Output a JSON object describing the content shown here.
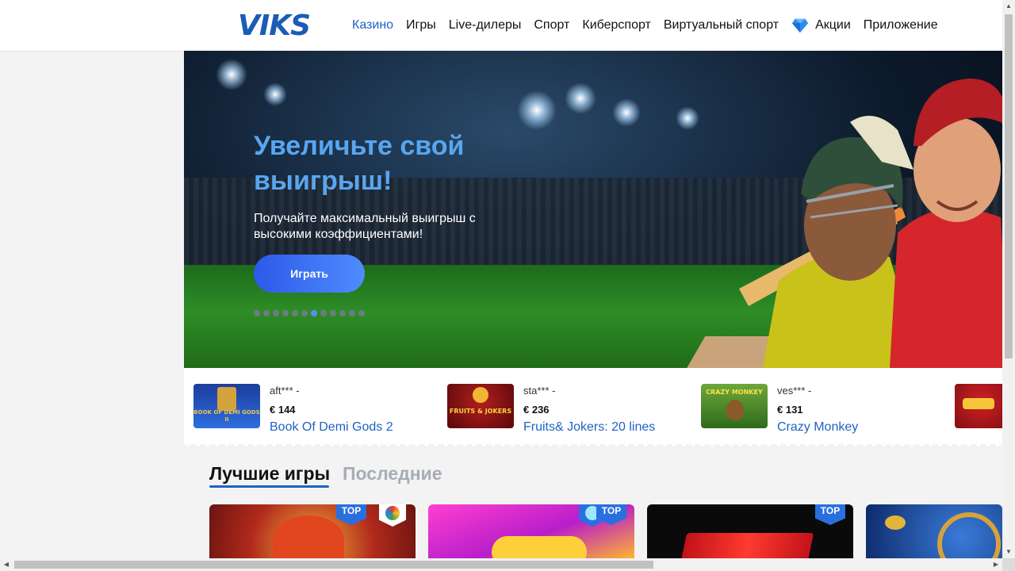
{
  "header": {
    "logo": "VIKS",
    "nav": [
      "Казино",
      "Игры",
      "Live-дилеры",
      "Спорт",
      "Киберспорт",
      "Виртуальный спорт",
      "Акции",
      "Приложение"
    ]
  },
  "banner": {
    "title": "Увеличьте свой выигрыш!",
    "subtitle": "Получайте максимальный выигрыш с высокими коэффициентами!",
    "button": "Играть",
    "slide_count": 12,
    "active_slide": 6
  },
  "winners": [
    {
      "user": "aft*** -",
      "amount": "€ 144",
      "game": "Book Of Demi Gods 2",
      "thumb_text": "BOOK OF DEMI GODS II"
    },
    {
      "user": "sta*** -",
      "amount": "€ 236",
      "game": "Fruits& Jokers: 20 lines",
      "thumb_text": "FRUITS & JOKERS"
    },
    {
      "user": "ves*** -",
      "amount": "€ 131",
      "game": "Crazy Monkey",
      "thumb_text": "CRAZY MONKEY"
    },
    {
      "user": "",
      "amount": "",
      "game": "",
      "thumb_text": ""
    }
  ],
  "tabs": {
    "best": "Лучшие игры",
    "recent": "Последние"
  },
  "cards": {
    "badge": "TOP"
  },
  "colors": {
    "accent": "#1e63c4",
    "banner_title": "#58a6f0",
    "button_start": "#2d59e8",
    "button_end": "#4f8cff"
  }
}
